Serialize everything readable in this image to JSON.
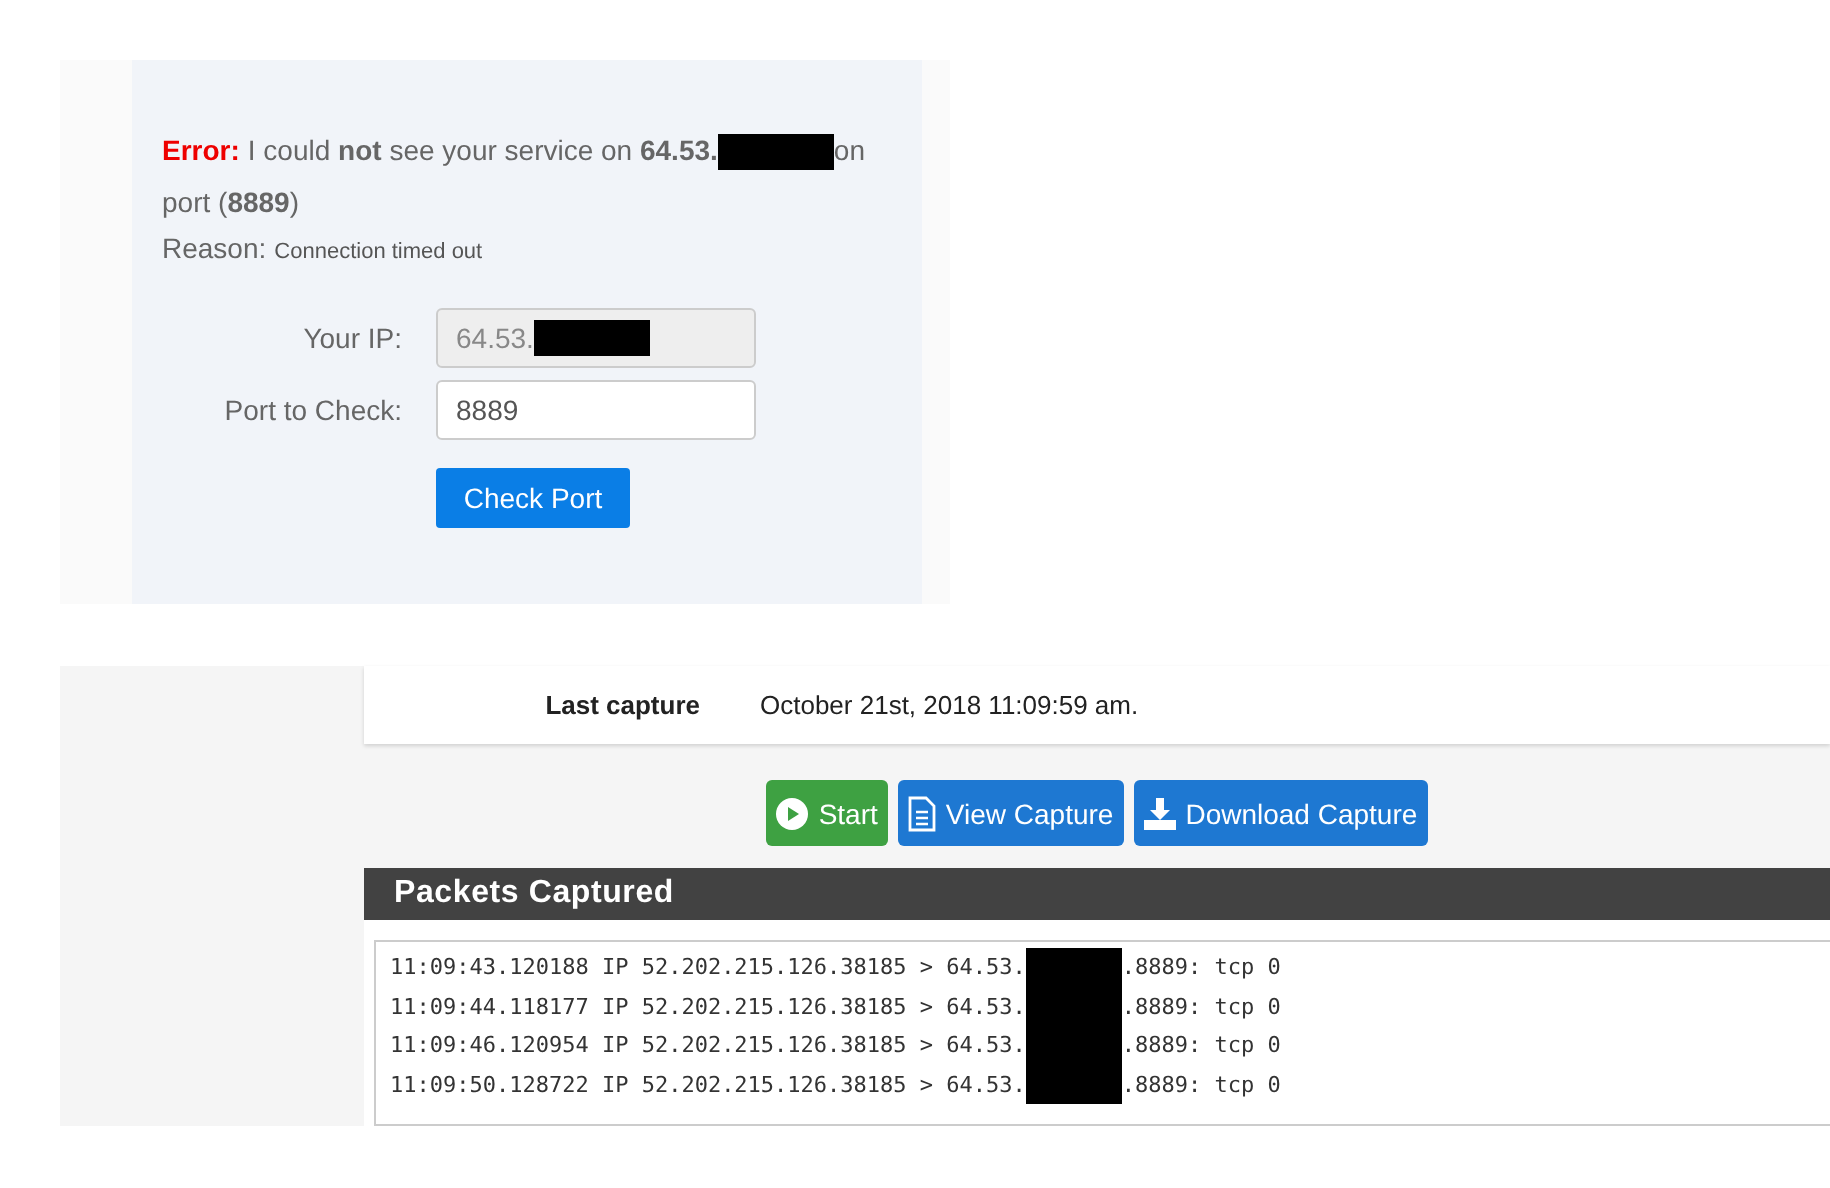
{
  "port_check": {
    "error_label": "Error:",
    "message_before": "I could **not** see your service on **64.53.**",
    "message_after": "on",
    "message_line2": "port (**8889**)",
    "reason_label": "Reason:",
    "reason": "Connection timed out",
    "fields": [
      {
        "label": "Your IP:",
        "value": "64.53.",
        "disabled": true,
        "redacted": true
      },
      {
        "label": "Port to Check:",
        "value": "8889",
        "disabled": false,
        "redacted": false
      }
    ],
    "button": "Check Port"
  },
  "capture": {
    "last_capture_label": "Last capture",
    "last_capture": "October 21st, 2018 11:09:59 am.",
    "buttons": [
      {
        "kind": "start",
        "label": "Start"
      },
      {
        "kind": "view",
        "label": "View Capture"
      },
      {
        "kind": "download",
        "label": "Download Capture"
      }
    ],
    "packets_title": "Packets Captured",
    "packets": [
      {
        "before": "11:09:43.120188 IP 52.202.215.126.38185 > 64.53.",
        "after": ".8889: tcp 0"
      },
      {
        "before": "11:09:44.118177 IP 52.202.215.126.38185 > 64.53.",
        "after": ".8889: tcp 0"
      },
      {
        "before": "11:09:46.120954 IP 52.202.215.126.38185 > 64.53.",
        "after": ".8889: tcp 0"
      },
      {
        "before": "11:09:50.128722 IP 52.202.215.126.38185 > 64.53.",
        "after": ".8889: tcp 0"
      }
    ]
  }
}
